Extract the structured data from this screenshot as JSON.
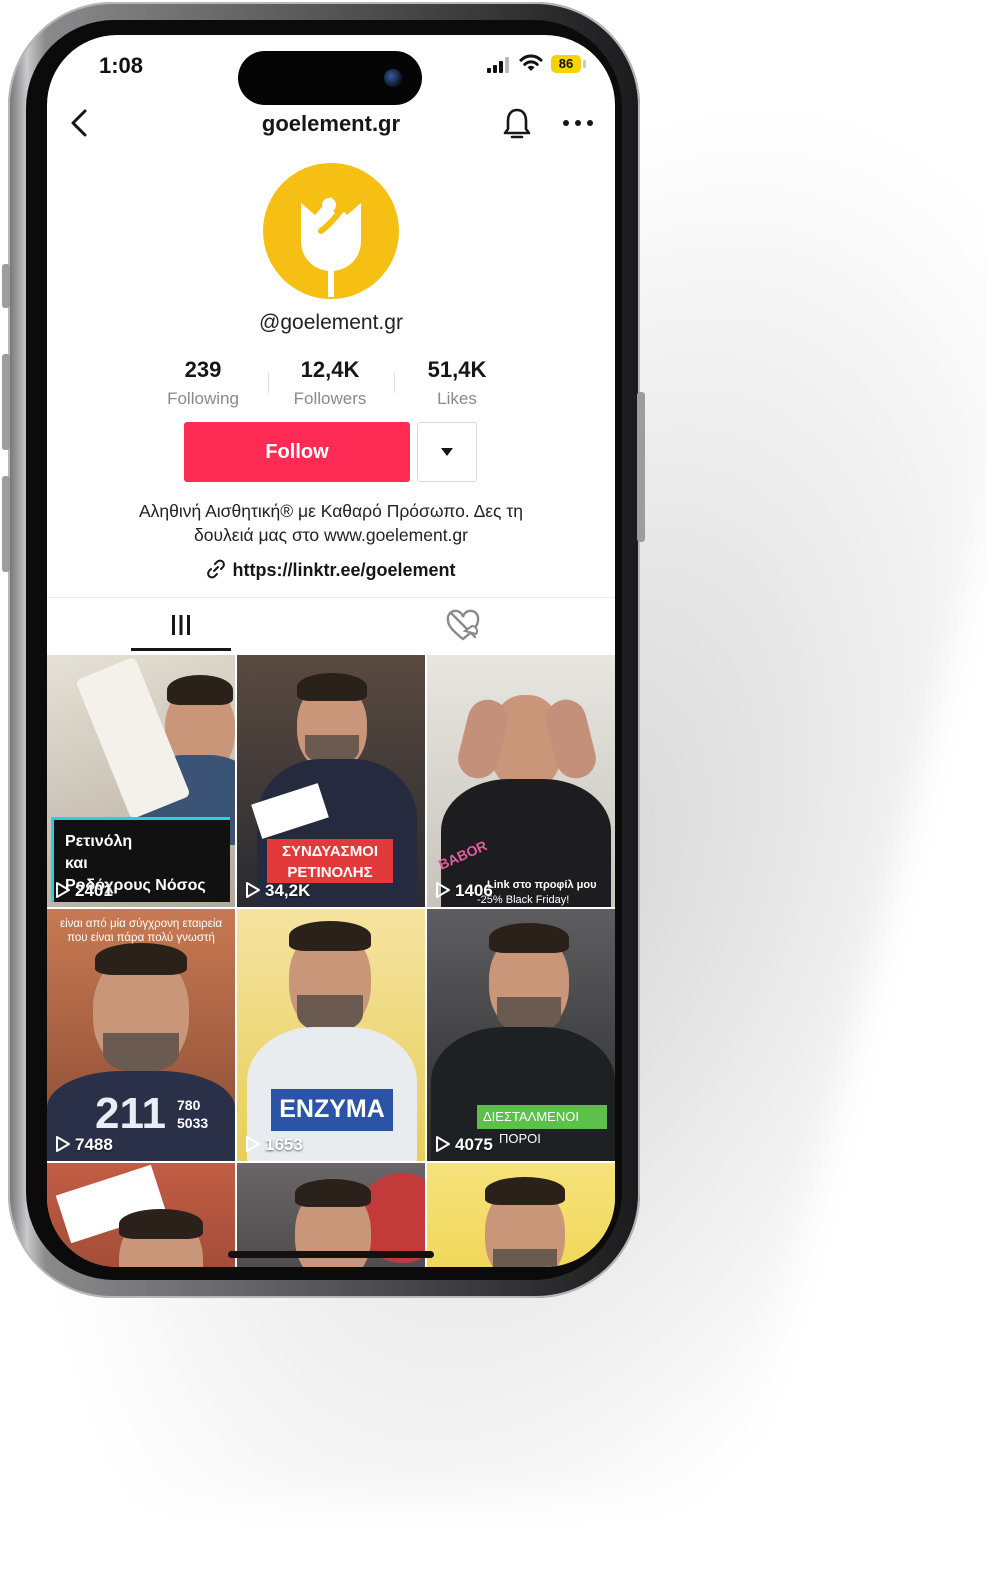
{
  "status": {
    "time": "1:08",
    "battery": "86"
  },
  "header": {
    "title": "goelement.gr"
  },
  "profile": {
    "handle": "@goelement.gr",
    "following_count": "239",
    "following_label": "Following",
    "followers_count": "12,4K",
    "followers_label": "Followers",
    "likes_count": "51,4K",
    "likes_label": "Likes",
    "follow_label": "Follow",
    "bio_line1": "Αληθινή Αισθητική® με Καθαρό Πρόσωπο. Δες τη",
    "bio_line2": "δουλειά μας στο www.goelement.gr",
    "link": "https://linktr.ee/goelement"
  },
  "colors": {
    "accent": "#fe2c55",
    "avatar_bg": "#f5c013"
  },
  "videos": [
    {
      "views": "2401",
      "caption": "Ρετινόλη\nκαι\nΡοδόχρους Νόσος"
    },
    {
      "views": "34,2K",
      "caption_1": "ΣΥΝΔΥΑΣΜΟΙ",
      "caption_2": "ΡΕΤΙΝΟΛΗΣ"
    },
    {
      "views": "1406",
      "caption_1": "Link στο προφίλ μου",
      "caption_2": "-25% Black Friday!",
      "logo": "BABOR"
    },
    {
      "views": "7488",
      "caption": "είναι από μία σύγχρονη εταιρεία που είναι πάρα πολύ γνωστή",
      "big_number": "211",
      "small_1": "780",
      "small_2": "5033"
    },
    {
      "views": "1653",
      "caption": "ΕΝΖΥΜΑ"
    },
    {
      "views": "4075",
      "caption_1": "ΔΙΕΣΤΑΛΜΕΝΟΙ",
      "caption_2": "ΠΟΡΟΙ"
    },
    {
      "views": ""
    },
    {
      "views": ""
    },
    {
      "views": ""
    }
  ]
}
